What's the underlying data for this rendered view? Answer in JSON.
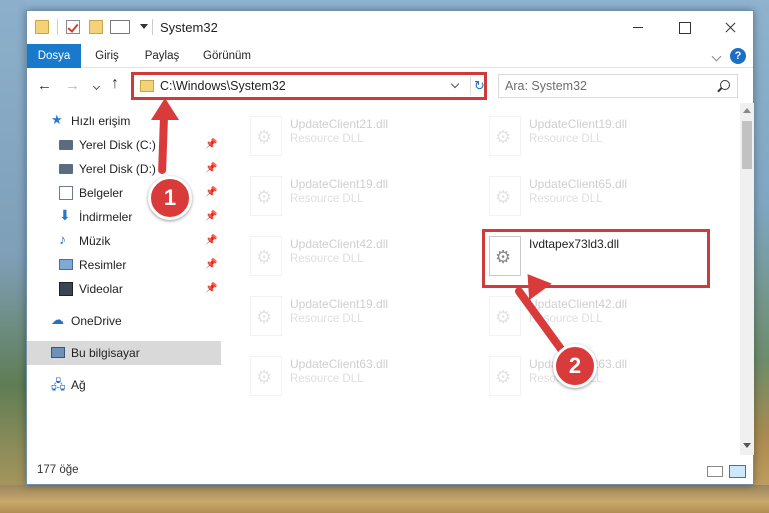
{
  "window": {
    "title": "System32"
  },
  "ribbon": {
    "tabs": [
      "Dosya",
      "Giriş",
      "Paylaş",
      "Görünüm"
    ]
  },
  "address": {
    "path": "C:\\Windows\\System32"
  },
  "search": {
    "placeholder": "Ara: System32"
  },
  "nav": {
    "quick_access": "Hızlı erişim",
    "items": [
      {
        "label": "Yerel Disk (C:)",
        "icon": "drive-icon",
        "pinned": true
      },
      {
        "label": "Yerel Disk (D:)",
        "icon": "drive-icon",
        "pinned": true
      },
      {
        "label": "Belgeler",
        "icon": "documents-icon",
        "pinned": true
      },
      {
        "label": "İndirmeler",
        "icon": "downloads-icon",
        "pinned": true
      },
      {
        "label": "Müzik",
        "icon": "music-icon",
        "pinned": true
      },
      {
        "label": "Resimler",
        "icon": "pictures-icon",
        "pinned": true
      },
      {
        "label": "Videolar",
        "icon": "videos-icon",
        "pinned": true
      }
    ],
    "onedrive": "OneDrive",
    "this_pc": "Bu bilgisayar",
    "network": "Ağ"
  },
  "files": [
    {
      "name": "UpdateClient21.dll",
      "type": "Resource DLL"
    },
    {
      "name": "UpdateClient19.dll",
      "type": "Resource DLL"
    },
    {
      "name": "UpdateClient19.dll",
      "type": "Resource DLL"
    },
    {
      "name": "UpdateClient65.dll",
      "type": "Resource DLL"
    },
    {
      "name": "UpdateClient42.dll",
      "type": "Resource DLL"
    },
    {
      "name": "Ivdtapex73ld3.dll",
      "type": ""
    },
    {
      "name": "UpdateClient19.dll",
      "type": "Resource DLL"
    },
    {
      "name": "UpdateClient42.dll",
      "type": "Resource DLL"
    },
    {
      "name": "UpdateClient63.dll",
      "type": "Resource DLL"
    },
    {
      "name": "UpdateClient63.dll",
      "type": "Resource DLL"
    }
  ],
  "status": {
    "count": "177 öğe"
  },
  "callouts": {
    "one": "1",
    "two": "2"
  },
  "colors": {
    "accent": "#1979ca",
    "highlight": "#cf3b3b",
    "selection": "#cce8ff"
  }
}
